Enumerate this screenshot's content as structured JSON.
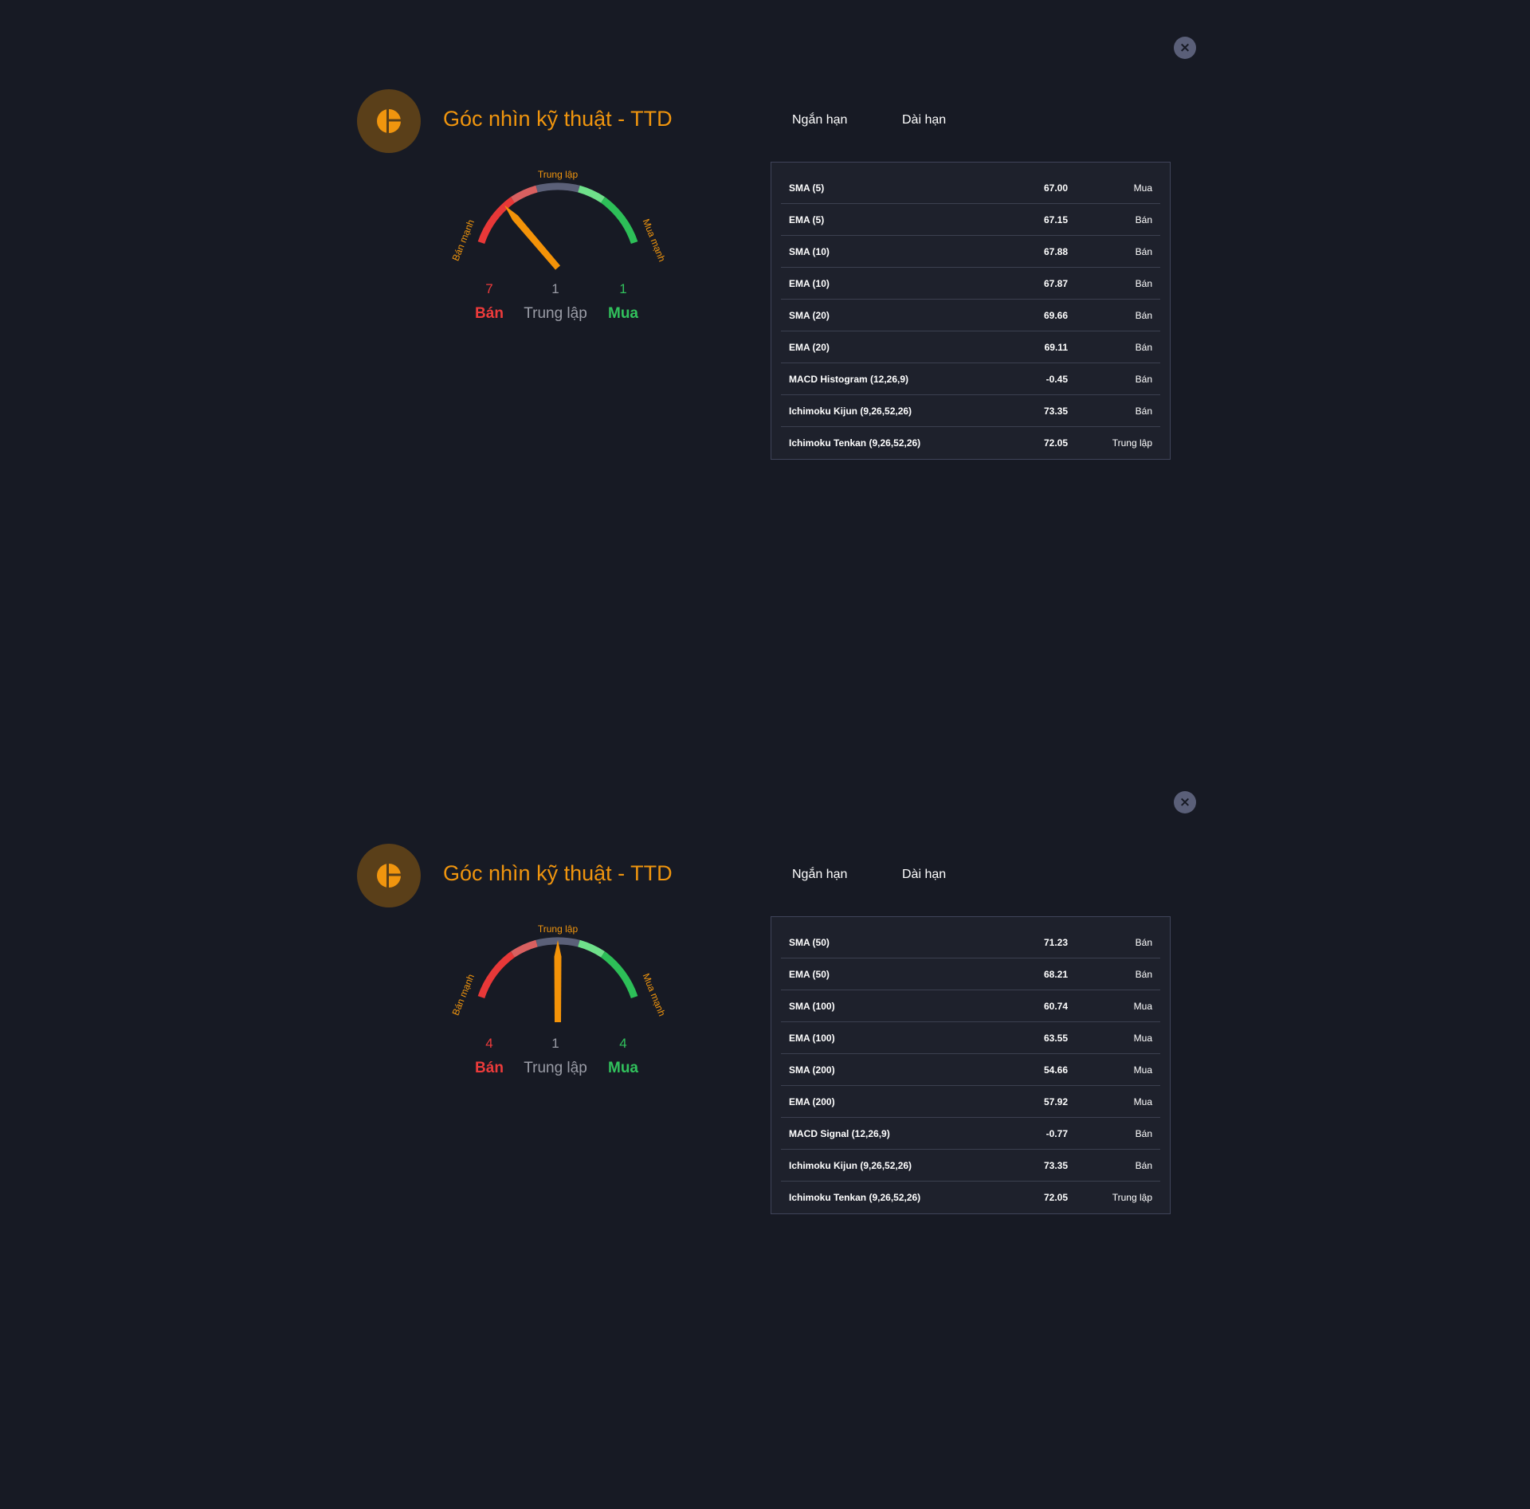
{
  "colors": {
    "background": "#171a24",
    "accent": "#f0950e",
    "sell": "#ec3b3b",
    "buy": "#31c15c",
    "neutral": "#9a9ca6"
  },
  "panels": [
    {
      "close_icon": "×",
      "title": "Góc nhìn kỹ thuật - TTD",
      "tabs": [
        {
          "label": "Ngắn hạn"
        },
        {
          "label": "Dài hạn"
        }
      ],
      "gauge": {
        "label_left": "Bán mạnh",
        "label_top": "Trung lập",
        "label_right": "Mua mạnh",
        "needle_level": -0.45
      },
      "counts": {
        "sell": "7",
        "sell_label": "Bán",
        "neutral": "1",
        "neutral_label": "Trung lập",
        "buy": "1",
        "buy_label": "Mua"
      },
      "rows": [
        {
          "name": "SMA (5)",
          "value": "67.00",
          "signal": "Mua",
          "type": "buy"
        },
        {
          "name": "EMA (5)",
          "value": "67.15",
          "signal": "Bán",
          "type": "sell"
        },
        {
          "name": "SMA (10)",
          "value": "67.88",
          "signal": "Bán",
          "type": "sell"
        },
        {
          "name": "EMA (10)",
          "value": "67.87",
          "signal": "Bán",
          "type": "sell"
        },
        {
          "name": "SMA (20)",
          "value": "69.66",
          "signal": "Bán",
          "type": "sell"
        },
        {
          "name": "EMA (20)",
          "value": "69.11",
          "signal": "Bán",
          "type": "sell"
        },
        {
          "name": "MACD Histogram (12,26,9)",
          "value": "-0.45",
          "signal": "Bán",
          "type": "sell"
        },
        {
          "name": "Ichimoku Kijun (9,26,52,26)",
          "value": "73.35",
          "signal": "Bán",
          "type": "sell"
        },
        {
          "name": "Ichimoku Tenkan (9,26,52,26)",
          "value": "72.05",
          "signal": "Trung lập",
          "type": "neutral"
        }
      ]
    },
    {
      "close_icon": "×",
      "title": "Góc nhìn kỹ thuật - TTD",
      "tabs": [
        {
          "label": "Ngắn hạn"
        },
        {
          "label": "Dài hạn"
        }
      ],
      "gauge": {
        "label_left": "Bán mạnh",
        "label_top": "Trung lập",
        "label_right": "Mua mạnh",
        "needle_level": 0
      },
      "counts": {
        "sell": "4",
        "sell_label": "Bán",
        "neutral": "1",
        "neutral_label": "Trung lập",
        "buy": "4",
        "buy_label": "Mua"
      },
      "rows": [
        {
          "name": "SMA (50)",
          "value": "71.23",
          "signal": "Bán",
          "type": "sell"
        },
        {
          "name": "EMA (50)",
          "value": "68.21",
          "signal": "Bán",
          "type": "sell"
        },
        {
          "name": "SMA (100)",
          "value": "60.74",
          "signal": "Mua",
          "type": "buy"
        },
        {
          "name": "EMA (100)",
          "value": "63.55",
          "signal": "Mua",
          "type": "buy"
        },
        {
          "name": "SMA (200)",
          "value": "54.66",
          "signal": "Mua",
          "type": "buy"
        },
        {
          "name": "EMA (200)",
          "value": "57.92",
          "signal": "Mua",
          "type": "buy"
        },
        {
          "name": "MACD Signal (12,26,9)",
          "value": "-0.77",
          "signal": "Bán",
          "type": "sell"
        },
        {
          "name": "Ichimoku Kijun (9,26,52,26)",
          "value": "73.35",
          "signal": "Bán",
          "type": "sell"
        },
        {
          "name": "Ichimoku Tenkan (9,26,52,26)",
          "value": "72.05",
          "signal": "Trung lập",
          "type": "neutral"
        }
      ]
    }
  ]
}
